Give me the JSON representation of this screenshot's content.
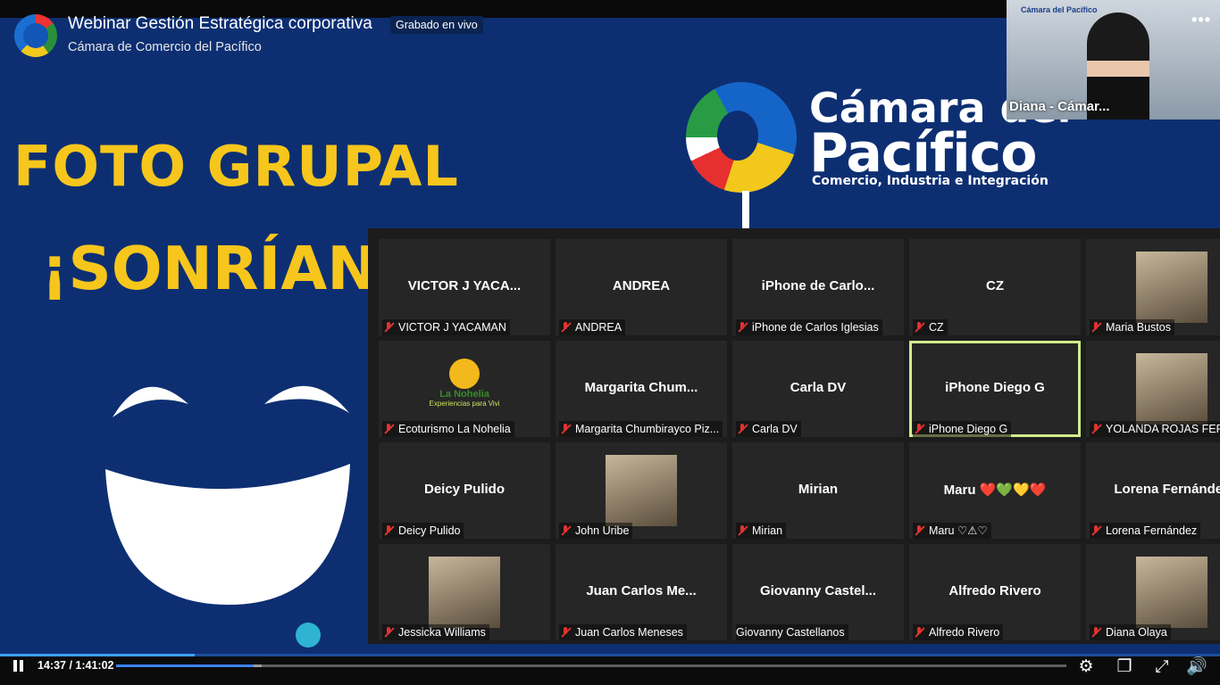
{
  "video": {
    "title": "Webinar Gestión Estratégica corporativa",
    "live_badge": "Grabado en vivo",
    "channel": "Cámara de Comercio del Pacífico"
  },
  "slide": {
    "heading": "FOTO GRUPAL",
    "subheading": "¡SONRÍAN!",
    "brand_line1": "Cámara del",
    "brand_line2": "Pacífico",
    "brand_line3": "Comercio, Industria e Integración"
  },
  "speaker": {
    "label": "Diana - Cámar...",
    "mini_logo": "Cámara del Pacífico"
  },
  "participants": [
    {
      "center": "VICTOR J YACA...",
      "label": "VICTOR J YACAMAN",
      "muted": true
    },
    {
      "center": "ANDREA",
      "label": "ANDREA",
      "muted": true
    },
    {
      "center": "iPhone  de  Carlo...",
      "label": "iPhone de Carlos Iglesias",
      "muted": true
    },
    {
      "center": "CZ",
      "label": "CZ",
      "muted": true
    },
    {
      "center": "",
      "label": "Maria Bustos",
      "muted": true,
      "photo": true
    },
    {
      "center": "",
      "label": "Ecoturismo La Nohelia",
      "muted": true,
      "logo_text": "La Nohelia",
      "logo_sub": "Experiencias para Vivi"
    },
    {
      "center": "Margarita  Chum...",
      "label": "Margarita Chumbirayco Piz...",
      "muted": true
    },
    {
      "center": "Carla DV",
      "label": "Carla DV",
      "muted": true
    },
    {
      "center": "iPhone  Diego G",
      "label": "iPhone  Diego G",
      "muted": true,
      "active": true
    },
    {
      "center": "",
      "label": "YOLANDA ROJAS FERN",
      "muted": true,
      "photo": true
    },
    {
      "center": "Deicy Pulido",
      "label": "Deicy Pulido",
      "muted": true
    },
    {
      "center": "",
      "label": "John Uribe",
      "muted": true,
      "photo": true
    },
    {
      "center": "Mirian",
      "label": "Mirian",
      "muted": true
    },
    {
      "center": "Maru ❤️💚💛❤️",
      "label": "Maru ♡⚠♡",
      "muted": true
    },
    {
      "center": "Lorena Fernández",
      "label": "Lorena Fernández",
      "muted": true
    },
    {
      "center": "",
      "label": "Jessicka Williams",
      "muted": true,
      "photo": true
    },
    {
      "center": "Juan  Carlos  Me...",
      "label": "Juan Carlos Meneses",
      "muted": true
    },
    {
      "center": "Giovanny  Castel...",
      "label": "Giovanny Castellanos",
      "muted": false
    },
    {
      "center": "Alfredo Rivero",
      "label": "Alfredo Rivero",
      "muted": true
    },
    {
      "center": "",
      "label": "Diana Olaya",
      "muted": true,
      "photo": true
    }
  ],
  "player": {
    "time": "14:37 / 1:41:02",
    "progress_fraction": 0.145,
    "buffer_fraction": 0.153,
    "icons": [
      "pause-icon",
      "gear-icon",
      "miniplayer-icon",
      "fullscreen-icon",
      "volume-icon"
    ]
  },
  "colors": {
    "slide_bg": "#0d2f72",
    "accent_yellow": "#f6c61c",
    "progress": "#3b82f6",
    "muted_red": "#e1332f",
    "active_border": "#d3ec8b"
  }
}
